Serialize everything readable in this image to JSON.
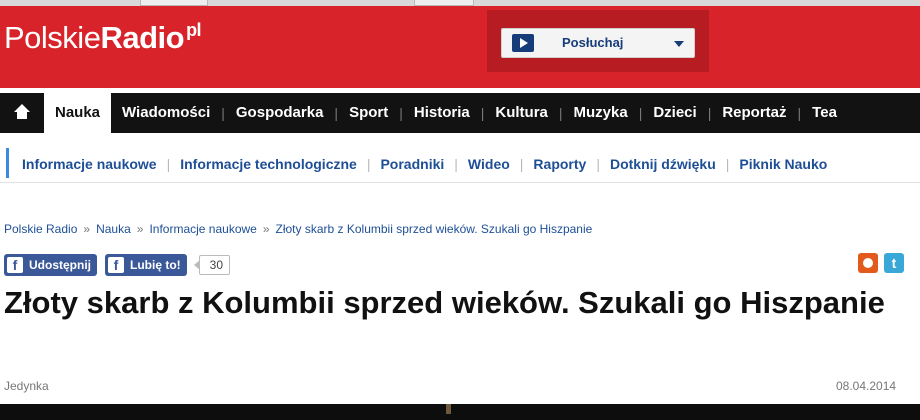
{
  "header": {
    "logo": {
      "part1": "Polskie",
      "part2": "Radio",
      "part3": "pl"
    },
    "player": {
      "label": "Posłuchaj"
    },
    "colors": {
      "brand_red": "#d8232a",
      "dark_red": "#b71c22",
      "player_blue": "#173c7a"
    }
  },
  "main_nav": {
    "home_icon": "home-icon",
    "items": [
      {
        "label": "Nauka",
        "active": true
      },
      {
        "label": "Wiadomości"
      },
      {
        "label": "Gospodarka"
      },
      {
        "label": "Sport"
      },
      {
        "label": "Historia"
      },
      {
        "label": "Kultura"
      },
      {
        "label": "Muzyka"
      },
      {
        "label": "Dzieci"
      },
      {
        "label": "Reportaż"
      },
      {
        "label": "Tea"
      }
    ]
  },
  "sub_nav": {
    "items": [
      {
        "label": "Informacje naukowe"
      },
      {
        "label": "Informacje technologiczne"
      },
      {
        "label": "Poradniki"
      },
      {
        "label": "Wideo"
      },
      {
        "label": "Raporty"
      },
      {
        "label": "Dotknij dźwięku"
      },
      {
        "label": "Piknik Nauko"
      }
    ]
  },
  "breadcrumb": {
    "items": [
      "Polskie Radio",
      "Nauka",
      "Informacje naukowe",
      "Złoty skarb z Kolumbii sprzed wieków. Szukali go Hiszpanie"
    ],
    "separator": "»"
  },
  "share": {
    "share_label": "Udostępnij",
    "like_label": "Lubię to!",
    "like_count": "30",
    "icons": [
      "facebook-icon",
      "blip-icon",
      "twitter-icon"
    ]
  },
  "article": {
    "title": "Złoty skarb z Kolumbii sprzed wieków. Szukali go Hiszpanie",
    "source": "Jedynka",
    "date": "08.04.2014"
  }
}
